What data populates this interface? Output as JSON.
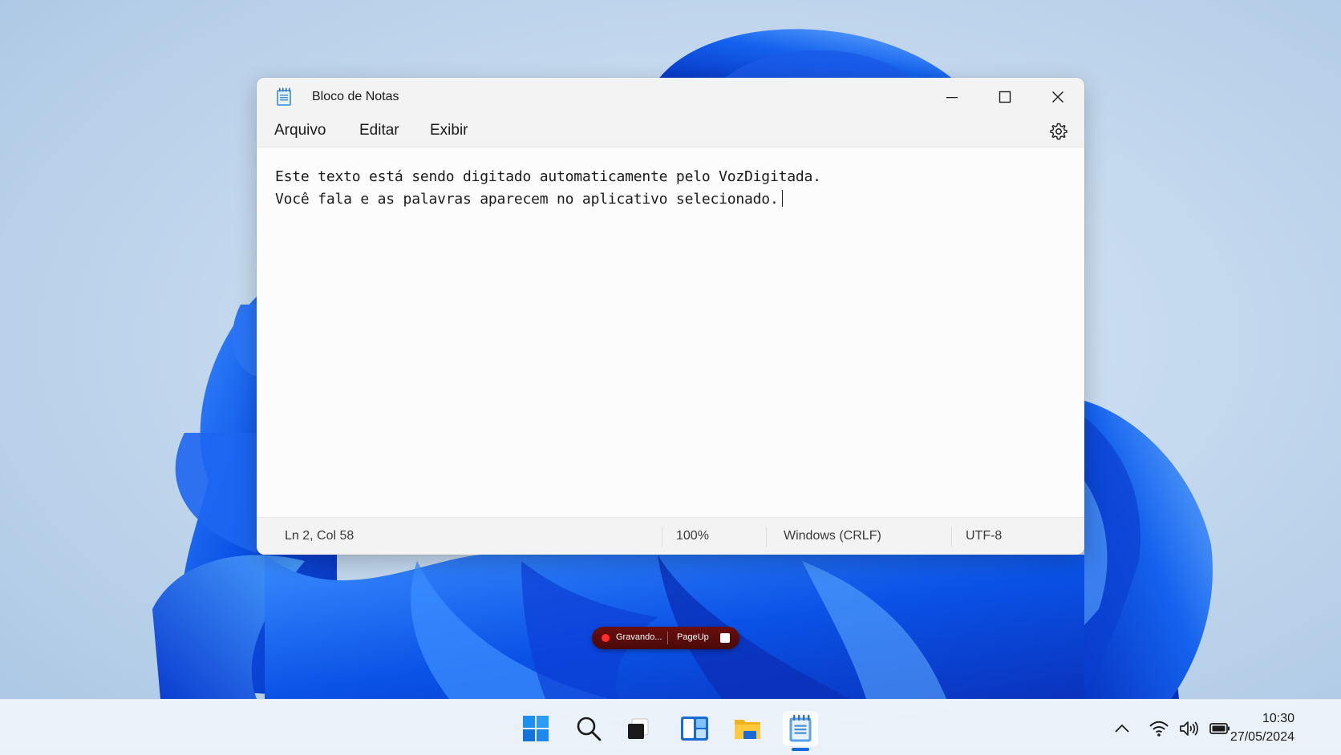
{
  "window": {
    "title": "Bloco de Notas",
    "app_icon": "notepad-icon",
    "controls": {
      "minimize_icon": "minimize-icon",
      "maximize_icon": "maximize-icon",
      "close_icon": "close-icon"
    }
  },
  "menu": {
    "items": [
      "Arquivo",
      "Editar",
      "Exibir"
    ],
    "settings_icon": "gear-icon"
  },
  "editor": {
    "lines": [
      "Este texto está sendo digitado automaticamente pelo VozDigitada.",
      "Você fala e as palavras aparecem no aplicativo selecionado."
    ]
  },
  "status": {
    "position": "Ln 2, Col 58",
    "zoom": "100%",
    "line_ending": "Windows (CRLF)",
    "encoding": "UTF-8"
  },
  "recorder": {
    "status": "Gravando...",
    "hotkey": "PageUp",
    "accent": "#ff2c2c"
  },
  "taskbar": {
    "apps": [
      "windows-start-icon",
      "search-icon",
      "task-view-icon",
      "widgets-icon",
      "file-explorer-icon",
      "notepad-icon"
    ],
    "tray": [
      "chevron-up-icon",
      "wifi-icon",
      "volume-icon",
      "battery-icon"
    ],
    "clock": {
      "time": "10:30",
      "date": "27/05/2024"
    }
  },
  "colors": {
    "accent": "#1a6ad6",
    "window_bg": "#fbfbfb"
  }
}
